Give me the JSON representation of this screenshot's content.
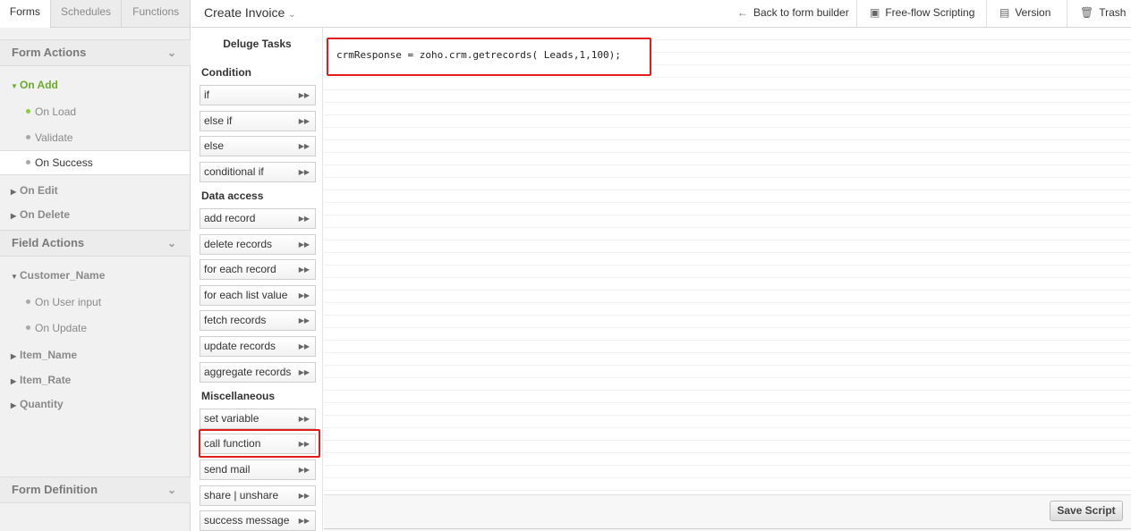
{
  "sidebar": {
    "tabs": [
      "Forms",
      "Schedules",
      "Functions"
    ],
    "form_actions": {
      "title": "Form Actions",
      "on_add": "On Add",
      "on_add_items": [
        "On Load",
        "Validate",
        "On Success"
      ],
      "on_edit": "On Edit",
      "on_delete": "On Delete"
    },
    "field_actions": {
      "title": "Field Actions",
      "customer_name": "Customer_Name",
      "customer_items": [
        "On User input",
        "On Update"
      ],
      "fields": [
        "Item_Name",
        "Item_Rate",
        "Quantity"
      ]
    },
    "form_definition": {
      "title": "Form Definition"
    }
  },
  "header": {
    "title": "Create Invoice",
    "back": "Back to form builder",
    "freeflow": "Free-flow Scripting",
    "version": "Version",
    "trash": "Trash"
  },
  "tasks": {
    "title": "Deluge Tasks",
    "condition": {
      "label": "Condition",
      "items": [
        "if",
        "else if",
        "else",
        "conditional if"
      ]
    },
    "data_access": {
      "label": "Data access",
      "items": [
        "add record",
        "delete records",
        "for each record",
        "for each list value",
        "fetch records",
        "update records",
        "aggregate records"
      ]
    },
    "misc": {
      "label": "Miscellaneous",
      "items": [
        "set variable",
        "call function",
        "send mail",
        "share | unshare",
        "success message"
      ]
    }
  },
  "editor": {
    "code": "crmResponse = zoho.crm.getrecords( Leads,1,100);"
  },
  "footer": {
    "save": "Save Script"
  },
  "colors": {
    "highlight": "#e21b1b",
    "active_event": "#6aaa2b"
  }
}
